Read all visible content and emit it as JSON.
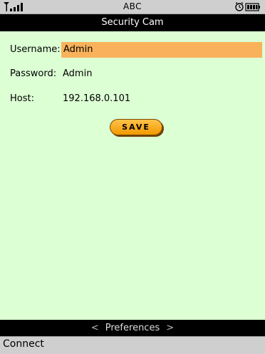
{
  "status_bar": {
    "carrier": "ABC",
    "signal_icon": "signal-strength-icon",
    "alarm_icon": "alarm-clock-icon",
    "battery_icon": "battery-icon"
  },
  "title_bar": {
    "title": "Security Cam"
  },
  "form": {
    "username": {
      "label": "Username:",
      "value": "Admin"
    },
    "password": {
      "label": "Password:",
      "value": "Admin"
    },
    "host": {
      "label": "Host:",
      "value": "192.168.0.101"
    },
    "save_label": "SAVE"
  },
  "softkey_bar": {
    "left_arrow": "<",
    "label": "Preferences",
    "right_arrow": ">"
  },
  "command_bar": {
    "left_softkey": "Connect"
  },
  "colors": {
    "background": "#dcffd4",
    "focus_highlight": "#f9b25b",
    "button": "#f29a00",
    "bars": "#000000",
    "status_bar": "#cfcfcf"
  }
}
